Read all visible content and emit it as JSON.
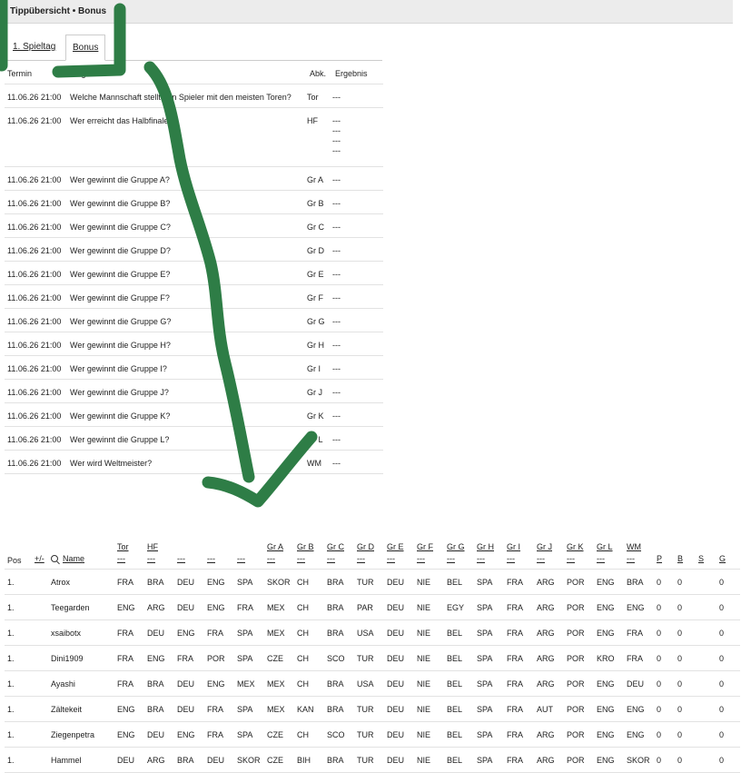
{
  "header": {
    "title": "Tippübersicht • Bonus"
  },
  "tabs": [
    {
      "label": "1. Spieltag"
    },
    {
      "label": "Bonus"
    }
  ],
  "bonus_table": {
    "headers": {
      "date": "Termin",
      "question": "Frage",
      "abbr": "Abk.",
      "result": "Ergebnis"
    },
    "rows": [
      {
        "date": "11.06.26 21:00",
        "question": "Welche Mannschaft stellt den Spieler mit den meisten Toren?",
        "abbr": "Tor",
        "result": [
          "---"
        ]
      },
      {
        "date": "11.06.26 21:00",
        "question": "Wer erreicht das Halbfinale?",
        "abbr": "HF",
        "result": [
          "---",
          "---",
          "---",
          "---"
        ]
      },
      {
        "date": "11.06.26 21:00",
        "question": "Wer gewinnt die Gruppe A?",
        "abbr": "Gr A",
        "result": [
          "---"
        ]
      },
      {
        "date": "11.06.26 21:00",
        "question": "Wer gewinnt die Gruppe B?",
        "abbr": "Gr B",
        "result": [
          "---"
        ]
      },
      {
        "date": "11.06.26 21:00",
        "question": "Wer gewinnt die Gruppe C?",
        "abbr": "Gr C",
        "result": [
          "---"
        ]
      },
      {
        "date": "11.06.26 21:00",
        "question": "Wer gewinnt die Gruppe D?",
        "abbr": "Gr D",
        "result": [
          "---"
        ]
      },
      {
        "date": "11.06.26 21:00",
        "question": "Wer gewinnt die Gruppe E?",
        "abbr": "Gr E",
        "result": [
          "---"
        ]
      },
      {
        "date": "11.06.26 21:00",
        "question": "Wer gewinnt die Gruppe F?",
        "abbr": "Gr F",
        "result": [
          "---"
        ]
      },
      {
        "date": "11.06.26 21:00",
        "question": "Wer gewinnt die Gruppe G?",
        "abbr": "Gr G",
        "result": [
          "---"
        ]
      },
      {
        "date": "11.06.26 21:00",
        "question": "Wer gewinnt die Gruppe H?",
        "abbr": "Gr H",
        "result": [
          "---"
        ]
      },
      {
        "date": "11.06.26 21:00",
        "question": "Wer gewinnt die Gruppe I?",
        "abbr": "Gr I",
        "result": [
          "---"
        ]
      },
      {
        "date": "11.06.26 21:00",
        "question": "Wer gewinnt die Gruppe J?",
        "abbr": "Gr J",
        "result": [
          "---"
        ]
      },
      {
        "date": "11.06.26 21:00",
        "question": "Wer gewinnt die Gruppe K?",
        "abbr": "Gr K",
        "result": [
          "---"
        ]
      },
      {
        "date": "11.06.26 21:00",
        "question": "Wer gewinnt die Gruppe L?",
        "abbr": "Gr L",
        "result": [
          "---"
        ]
      },
      {
        "date": "11.06.26 21:00",
        "question": "Wer wird Weltmeister?",
        "abbr": "WM",
        "result": [
          "---"
        ]
      }
    ]
  },
  "ranking": {
    "headers": {
      "pos": "Pos",
      "plusminus": "+/-",
      "name": "Name",
      "p": "P",
      "b": "B",
      "s": "S",
      "g": "G"
    },
    "tip_columns": [
      {
        "label": "Tor",
        "result": "---"
      },
      {
        "label": "HF",
        "result": "---"
      },
      {
        "label": "",
        "result": "---"
      },
      {
        "label": "",
        "result": "---"
      },
      {
        "label": "",
        "result": "---"
      },
      {
        "label": "Gr A",
        "result": "---"
      },
      {
        "label": "Gr B",
        "result": "---"
      },
      {
        "label": "Gr C",
        "result": "---"
      },
      {
        "label": "Gr D",
        "result": "---"
      },
      {
        "label": "Gr E",
        "result": "---"
      },
      {
        "label": "Gr F",
        "result": "---"
      },
      {
        "label": "Gr G",
        "result": "---"
      },
      {
        "label": "Gr H",
        "result": "---"
      },
      {
        "label": "Gr I",
        "result": "---"
      },
      {
        "label": "Gr J",
        "result": "---"
      },
      {
        "label": "Gr K",
        "result": "---"
      },
      {
        "label": "Gr L",
        "result": "---"
      },
      {
        "label": "WM",
        "result": "---"
      }
    ],
    "rows": [
      {
        "pos": "1.",
        "name": "Atrox",
        "tips": [
          "FRA",
          "BRA",
          "DEU",
          "ENG",
          "SPA",
          "SKOR",
          "CH",
          "BRA",
          "TUR",
          "DEU",
          "NIE",
          "BEL",
          "SPA",
          "FRA",
          "ARG",
          "POR",
          "ENG",
          "BRA"
        ],
        "p": "0",
        "b": "0",
        "s": "",
        "g": "0"
      },
      {
        "pos": "1.",
        "name": "Teegarden",
        "tips": [
          "ENG",
          "ARG",
          "DEU",
          "ENG",
          "FRA",
          "MEX",
          "CH",
          "BRA",
          "PAR",
          "DEU",
          "NIE",
          "EGY",
          "SPA",
          "FRA",
          "ARG",
          "POR",
          "ENG",
          "ENG"
        ],
        "p": "0",
        "b": "0",
        "s": "",
        "g": "0"
      },
      {
        "pos": "1.",
        "name": "xsaibotx",
        "tips": [
          "FRA",
          "DEU",
          "ENG",
          "FRA",
          "SPA",
          "MEX",
          "CH",
          "BRA",
          "USA",
          "DEU",
          "NIE",
          "BEL",
          "SPA",
          "FRA",
          "ARG",
          "POR",
          "ENG",
          "FRA"
        ],
        "p": "0",
        "b": "0",
        "s": "",
        "g": "0"
      },
      {
        "pos": "1.",
        "name": "Dini1909",
        "tips": [
          "FRA",
          "ENG",
          "FRA",
          "POR",
          "SPA",
          "CZE",
          "CH",
          "SCO",
          "TUR",
          "DEU",
          "NIE",
          "BEL",
          "SPA",
          "FRA",
          "ARG",
          "POR",
          "KRO",
          "FRA"
        ],
        "p": "0",
        "b": "0",
        "s": "",
        "g": "0"
      },
      {
        "pos": "1.",
        "name": "Ayashi",
        "tips": [
          "FRA",
          "BRA",
          "DEU",
          "ENG",
          "MEX",
          "MEX",
          "CH",
          "BRA",
          "USA",
          "DEU",
          "NIE",
          "BEL",
          "SPA",
          "FRA",
          "ARG",
          "POR",
          "ENG",
          "DEU"
        ],
        "p": "0",
        "b": "0",
        "s": "",
        "g": "0"
      },
      {
        "pos": "1.",
        "name": "Zältekeit",
        "tips": [
          "ENG",
          "BRA",
          "DEU",
          "FRA",
          "SPA",
          "MEX",
          "KAN",
          "BRA",
          "TUR",
          "DEU",
          "NIE",
          "BEL",
          "SPA",
          "FRA",
          "AUT",
          "POR",
          "ENG",
          "ENG"
        ],
        "p": "0",
        "b": "0",
        "s": "",
        "g": "0"
      },
      {
        "pos": "1.",
        "name": "Ziegenpetra",
        "tips": [
          "ENG",
          "DEU",
          "ENG",
          "FRA",
          "SPA",
          "CZE",
          "CH",
          "SCO",
          "TUR",
          "DEU",
          "NIE",
          "BEL",
          "SPA",
          "FRA",
          "ARG",
          "POR",
          "ENG",
          "ENG"
        ],
        "p": "0",
        "b": "0",
        "s": "",
        "g": "0"
      },
      {
        "pos": "1.",
        "name": "Hammel",
        "tips": [
          "DEU",
          "ARG",
          "BRA",
          "DEU",
          "SKOR",
          "CZE",
          "BIH",
          "BRA",
          "TUR",
          "DEU",
          "NIE",
          "BEL",
          "SPA",
          "FRA",
          "ARG",
          "POR",
          "ENG",
          "SKOR"
        ],
        "p": "0",
        "b": "0",
        "s": "",
        "g": "0"
      }
    ]
  },
  "annotation": {
    "color": "#2e7d46"
  }
}
